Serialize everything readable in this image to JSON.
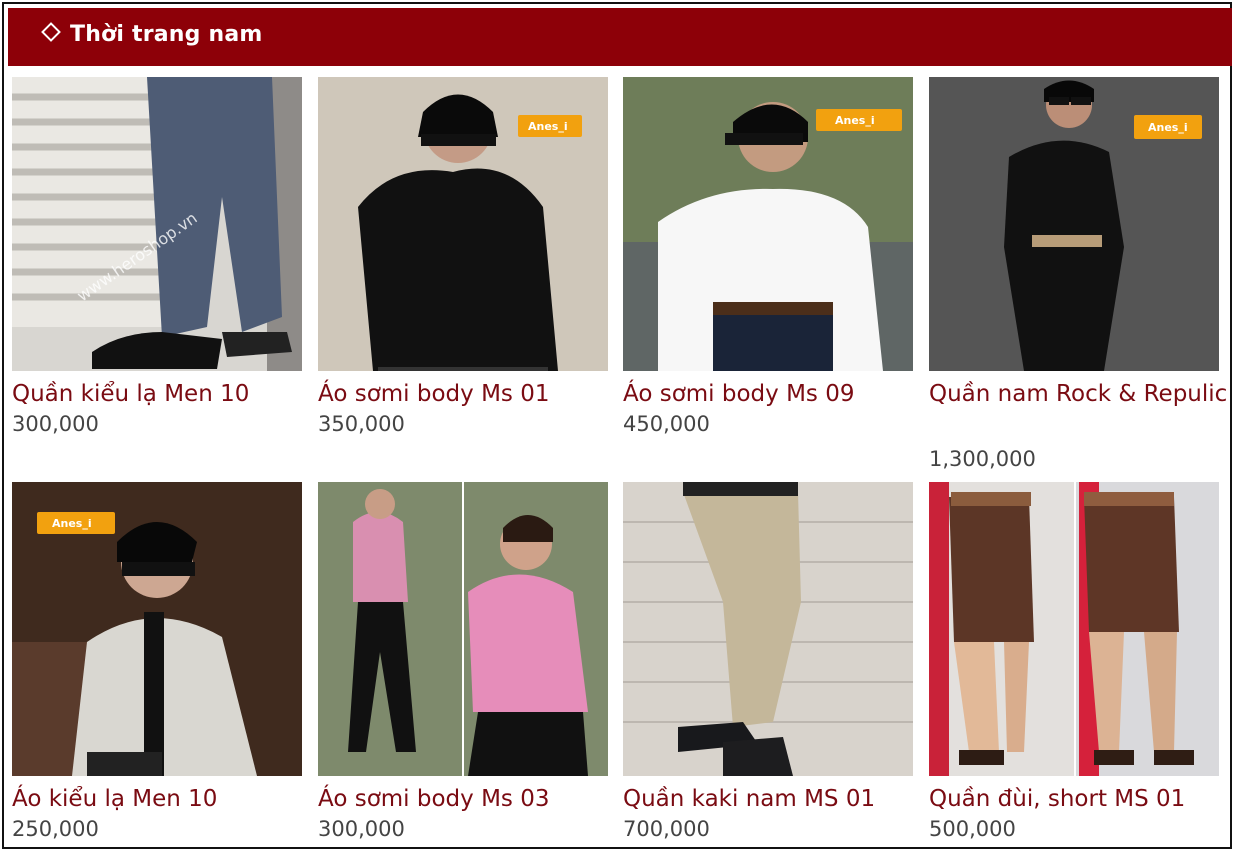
{
  "section": {
    "title": "Thời trang nam",
    "icon": "diamond-icon"
  },
  "products": [
    {
      "name": "Quần kiểu lạ Men 10",
      "price": "300,000",
      "watermark": "www.heroshop.vn"
    },
    {
      "name": "Áo sơmi body Ms 01",
      "price": "350,000",
      "badge": "Anes_i"
    },
    {
      "name": "Áo sơmi body Ms 09",
      "price": "450,000",
      "badge": "Anes_i"
    },
    {
      "name": "Quần nam Rock & Repulic",
      "price": "1,300,000",
      "badge": "Anes_i"
    },
    {
      "name": "Áo kiểu lạ Men 10",
      "price": "250,000",
      "badge": "Anes_i"
    },
    {
      "name": "Áo sơmi body Ms 03",
      "price": "300,000"
    },
    {
      "name": "Quần kaki nam MS 01",
      "price": "700,000"
    },
    {
      "name": "Quần đùi, short MS 01",
      "price": "500,000"
    }
  ],
  "colors": {
    "header_bg": "#8d0008",
    "product_name": "#7a0b12",
    "price": "#444444"
  }
}
